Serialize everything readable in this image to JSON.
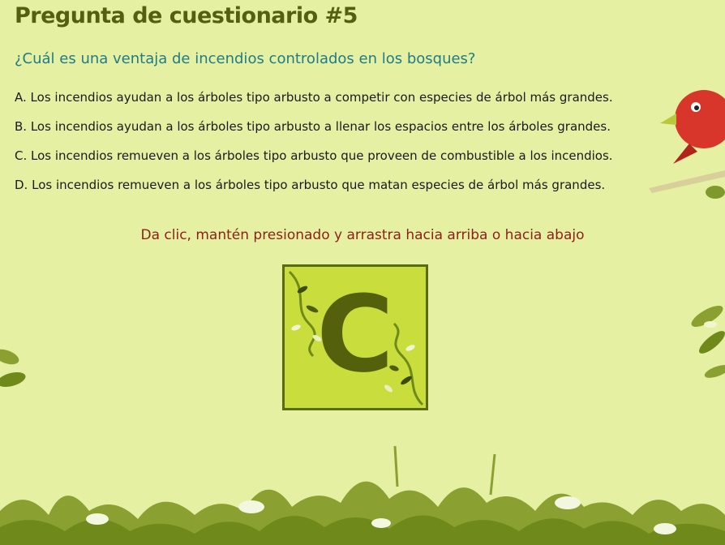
{
  "quiz": {
    "title": "Pregunta de cuestionario #5",
    "question": "¿Cuál es una ventaja de incendios controlados en los bosques?",
    "options": [
      {
        "letter": "A.",
        "text": "Los incendios ayudan a los árboles tipo arbusto a competir con especies de árbol más grandes."
      },
      {
        "letter": "B.",
        "text": "Los incendios ayudan a los árboles tipo arbusto a llenar los espacios entre los árboles grandes."
      },
      {
        "letter": "C.",
        "text": "Los incendios remueven a los árboles tipo arbusto que proveen de combustible a los incendios."
      },
      {
        "letter": "D.",
        "text": "Los incendios remueven a los árboles tipo arbusto que matan especies de árbol más grandes."
      }
    ],
    "instruction": "Da clic, mantén presionado y arrastra hacia arriba o hacia abajo",
    "selector": {
      "current_letter": "C"
    }
  },
  "decor": {
    "bird": "red-bird-icon",
    "foliage": "grass-foliage"
  },
  "colors": {
    "background": "#e6f0a3",
    "title": "#555f14",
    "question": "#1f7c86",
    "instruction": "#8c1f1a",
    "tile": "#c9dd3c",
    "tile_border": "#5a6a10"
  }
}
